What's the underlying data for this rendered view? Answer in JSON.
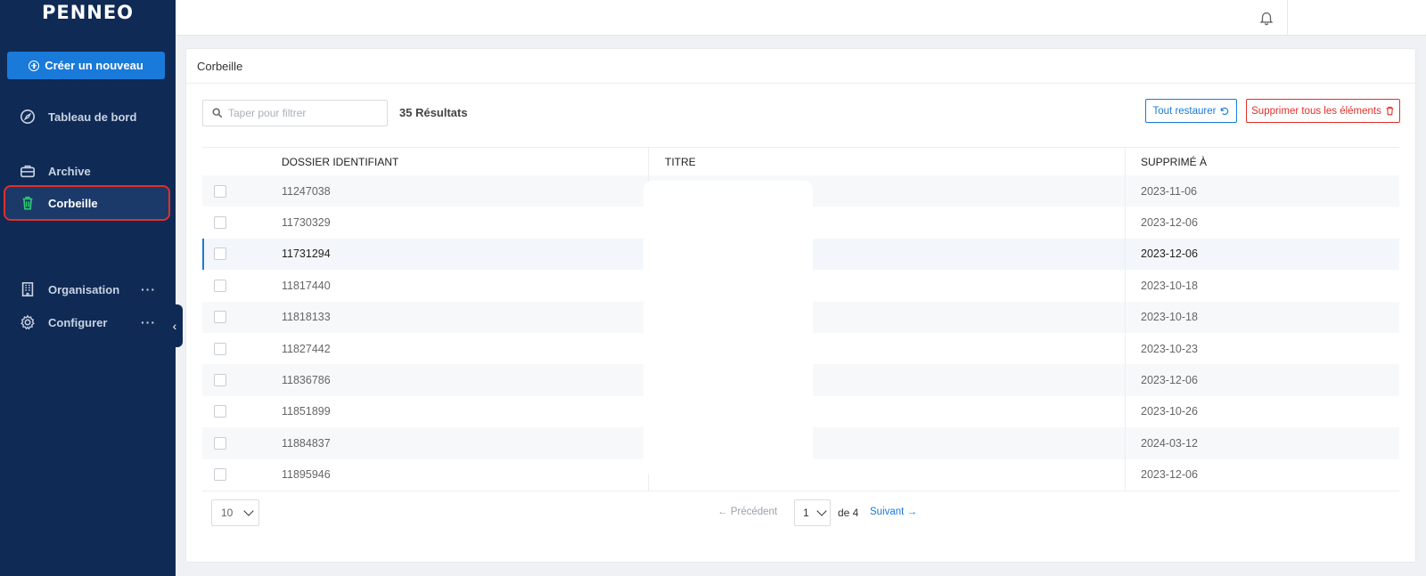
{
  "sidebar": {
    "logo": "PENNEO",
    "create_button": "Créer un nouveau",
    "items": [
      {
        "label": "Tableau de bord",
        "icon": "compass-icon"
      },
      {
        "label": "Archive",
        "icon": "briefcase-icon"
      },
      {
        "label": "Corbeille",
        "icon": "trash-icon",
        "active": true
      },
      {
        "label": "Organisation",
        "icon": "building-icon",
        "more": "···"
      },
      {
        "label": "Configurer",
        "icon": "gear-icon",
        "more": "···"
      }
    ],
    "collapse_glyph": "‹"
  },
  "card": {
    "title": "Corbeille"
  },
  "toolbar": {
    "filter_placeholder": "Taper pour filtrer",
    "results": "35 Résultats",
    "restore_label": "Tout restaurer",
    "delete_label": "Supprimer tous les éléments"
  },
  "table": {
    "headers": {
      "id": "DOSSIER IDENTIFIANT",
      "title": "TITRE",
      "deleted": "SUPPRIMÉ À"
    },
    "rows": [
      {
        "id": "11247038",
        "deleted": "2023-11-06"
      },
      {
        "id": "11730329",
        "deleted": "2023-12-06"
      },
      {
        "id": "11731294",
        "deleted": "2023-12-06"
      },
      {
        "id": "11817440",
        "deleted": "2023-10-18"
      },
      {
        "id": "11818133",
        "deleted": "2023-10-18"
      },
      {
        "id": "11827442",
        "deleted": "2023-10-23"
      },
      {
        "id": "11836786",
        "deleted": "2023-12-06"
      },
      {
        "id": "11851899",
        "deleted": "2023-10-26"
      },
      {
        "id": "11884837",
        "deleted": "2024-03-12"
      },
      {
        "id": "11895946",
        "deleted": "2023-12-06"
      }
    ]
  },
  "pagination": {
    "per_page": "10",
    "previous": "Précédent",
    "current_page": "1",
    "of_pages": "de 4",
    "next": "Suivant"
  },
  "colors": {
    "sidebar_bg": "#0f2a55",
    "accent": "#1a7ad9",
    "danger": "#e0302a",
    "active_icon": "#2ecc71"
  }
}
